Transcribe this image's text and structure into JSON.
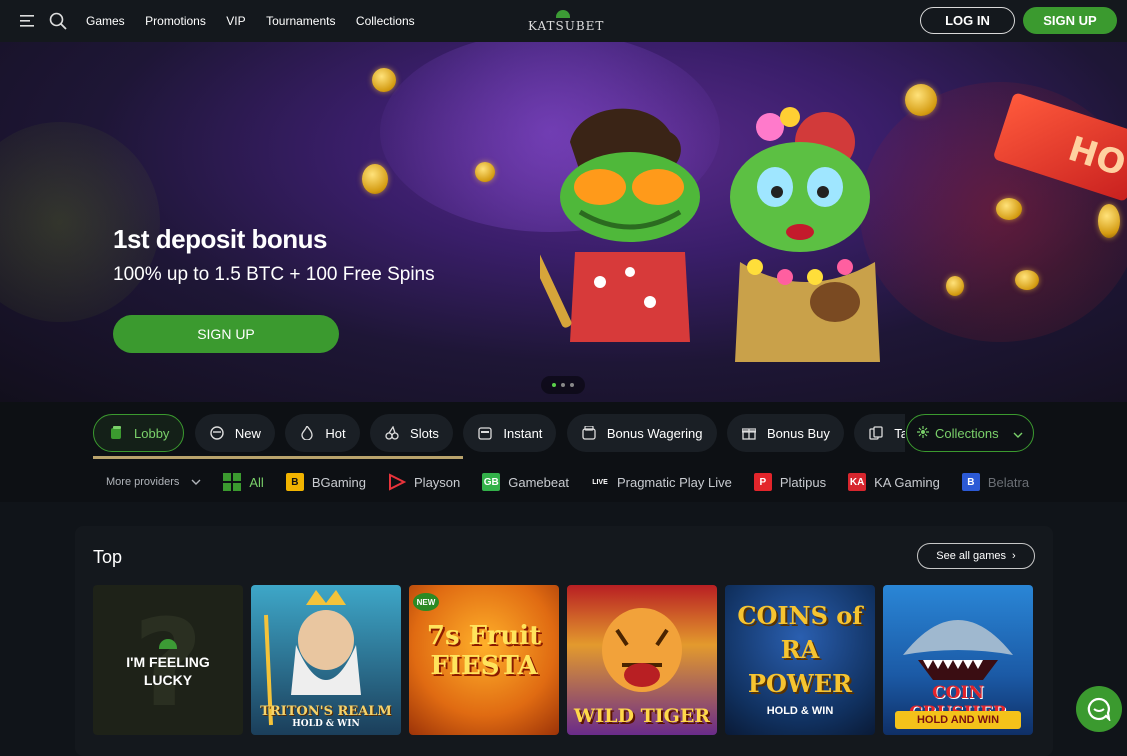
{
  "brand": {
    "name": "KATSUBET",
    "accent": "#3b9a2f",
    "gold": "#b9a36c"
  },
  "header": {
    "nav": [
      "Games",
      "Promotions",
      "VIP",
      "Tournaments",
      "Collections"
    ],
    "login_label": "LOG IN",
    "signup_label": "SIGN UP"
  },
  "hero": {
    "title": "1st deposit bonus",
    "subtitle": "100% up to 1.5 BTC + 100 Free Spins",
    "cta_label": "SIGN UP",
    "slide_count": 3,
    "active_slide": 1
  },
  "categories": {
    "items": [
      {
        "label": "Lobby",
        "icon": "lobby-icon",
        "active": true
      },
      {
        "label": "New",
        "icon": "new-icon"
      },
      {
        "label": "Hot",
        "icon": "fire-icon"
      },
      {
        "label": "Slots",
        "icon": "slots-icon"
      },
      {
        "label": "Instant",
        "icon": "instant-icon"
      },
      {
        "label": "Bonus Wagering",
        "icon": "bonus-wagering-icon"
      },
      {
        "label": "Bonus Buy",
        "icon": "gift-icon"
      },
      {
        "label": "Table Games",
        "icon": "cards-icon"
      }
    ],
    "collections_label": "Collections"
  },
  "providers": {
    "more_label": "More providers",
    "items": [
      "All",
      "BGaming",
      "Playson",
      "Gamebeat",
      "Pragmatic Play Live",
      "Platipus",
      "KA Gaming",
      "Belatra"
    ]
  },
  "top_section": {
    "title": "Top",
    "see_all_label": "See all games",
    "lucky_label_line1": "I'M FEELING",
    "lucky_label_line2": "LUCKY",
    "games": [
      {
        "title": "TRITON'S REALM",
        "sub": "HOLD & WIN"
      },
      {
        "title": "7s Fruit FIESTA",
        "badge": "NEW"
      },
      {
        "title": "WILD TIGER"
      },
      {
        "title": "COINS of RA POWER",
        "sub": "HOLD & WIN"
      },
      {
        "title": "COIN CRUSHER",
        "sub": "HOLD AND WIN"
      }
    ]
  }
}
